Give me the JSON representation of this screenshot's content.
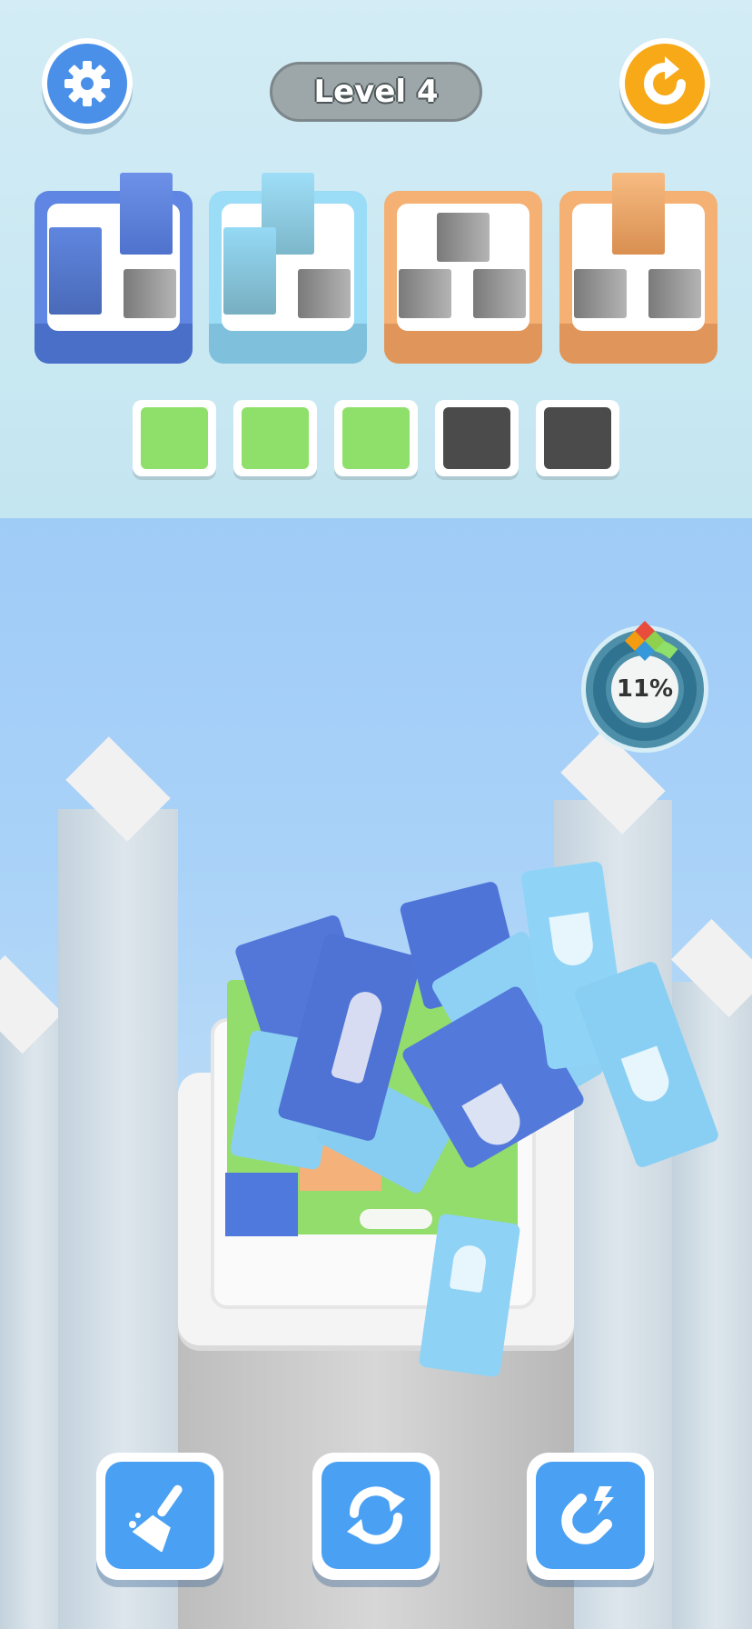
{
  "header": {
    "level_label": "Level 4",
    "settings_icon": "gear-icon",
    "restart_icon": "restart-arrow-icon"
  },
  "goal_slots": [
    {
      "color": "#4a78d6",
      "filled": 2,
      "total": 3
    },
    {
      "color": "#8fd4f3",
      "filled": 2,
      "total": 3
    },
    {
      "color": "#f2a867",
      "filled": 0,
      "total": 3
    },
    {
      "color": "#f2a867",
      "filled": 1,
      "total": 3
    }
  ],
  "tray": [
    {
      "state": "green",
      "color": "#8fe06a"
    },
    {
      "state": "green",
      "color": "#8fe06a"
    },
    {
      "state": "green",
      "color": "#8fe06a"
    },
    {
      "state": "empty",
      "color": "#4b4b4b"
    },
    {
      "state": "empty",
      "color": "#4b4b4b"
    }
  ],
  "progress": {
    "percent_label": "11%",
    "value": 0.11,
    "icon": "color-diamond-icon"
  },
  "tools": [
    {
      "name": "broom",
      "icon": "broom-icon"
    },
    {
      "name": "shuffle",
      "icon": "shuffle-icon"
    },
    {
      "name": "magnet",
      "icon": "magnet-icon"
    }
  ],
  "colors": {
    "dark_blue_block": "#4f79dd",
    "light_blue_block": "#8fd3f5",
    "green_block": "#93dd6c",
    "orange_block": "#f4b27a",
    "button_blue": "#4aa0f2",
    "restart_orange": "#f7a917"
  }
}
